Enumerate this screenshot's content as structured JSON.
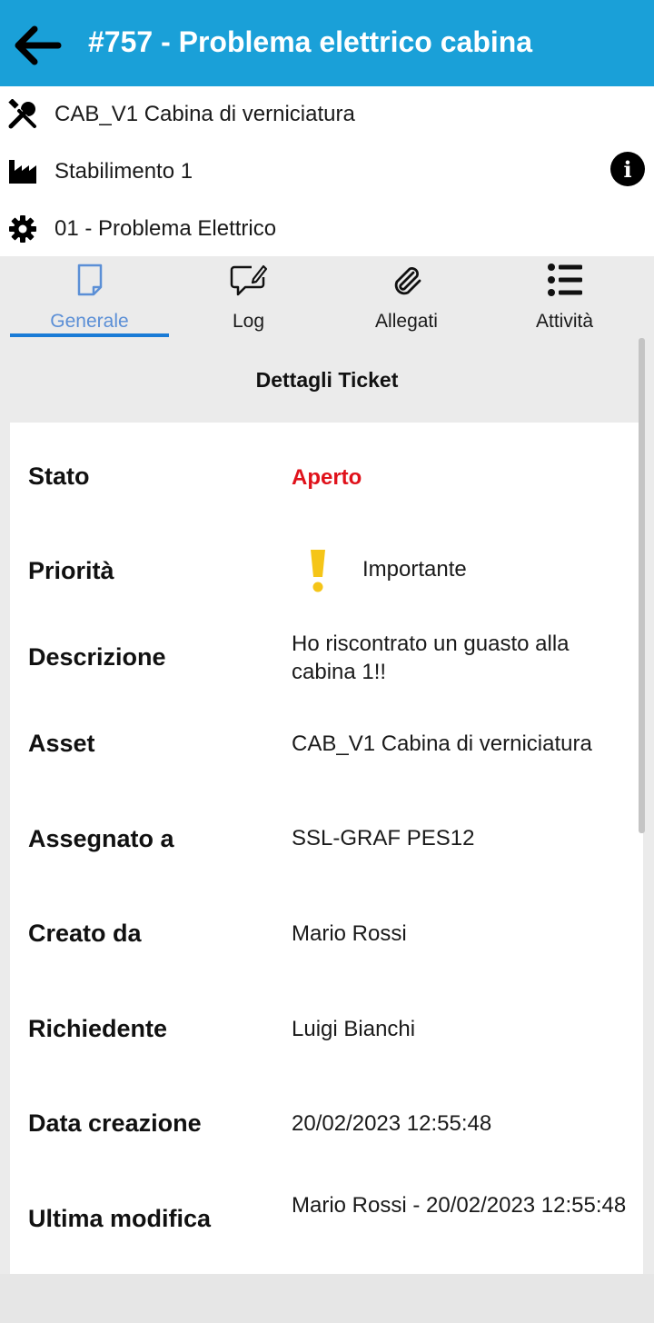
{
  "header": {
    "title": "#757 - Problema elettrico cabina",
    "back_icon": "arrow-left-icon",
    "background_color": "#1aa0d8"
  },
  "info": {
    "asset": "CAB_V1 Cabina di verniciatura",
    "plant": "Stabilimento 1",
    "category": "01 - Problema Elettrico",
    "info_button_glyph": "i"
  },
  "tabs": [
    {
      "label": "Generale",
      "icon": "document-icon",
      "active": true
    },
    {
      "label": "Log",
      "icon": "comment-edit-icon",
      "active": false
    },
    {
      "label": "Allegati",
      "icon": "paperclip-icon",
      "active": false
    },
    {
      "label": "Attività",
      "icon": "list-icon",
      "active": false
    }
  ],
  "details": {
    "section_title": "Dettagli Ticket",
    "rows": [
      {
        "label": "Stato",
        "value": "Aperto"
      },
      {
        "label": "Priorità",
        "value": "Importante"
      },
      {
        "label": "Descrizione",
        "value": "Ho riscontrato un guasto alla cabina 1!!"
      },
      {
        "label": "Asset",
        "value": "CAB_V1 Cabina di verniciatura"
      },
      {
        "label": "Assegnato a",
        "value": "SSL-GRAF PES12"
      },
      {
        "label": "Creato da",
        "value": "Mario Rossi"
      },
      {
        "label": "Richiedente",
        "value": "Luigi Bianchi"
      },
      {
        "label": "Data creazione",
        "value": "20/02/2023 12:55:48"
      },
      {
        "label": "Ultima modifica",
        "value": "Mario Rossi - 20/02/2023 12:55:48"
      }
    ]
  },
  "colors": {
    "status_open": "#e0121b",
    "priority_important": "#f5c518",
    "active_tab": "#5b8fd6"
  }
}
